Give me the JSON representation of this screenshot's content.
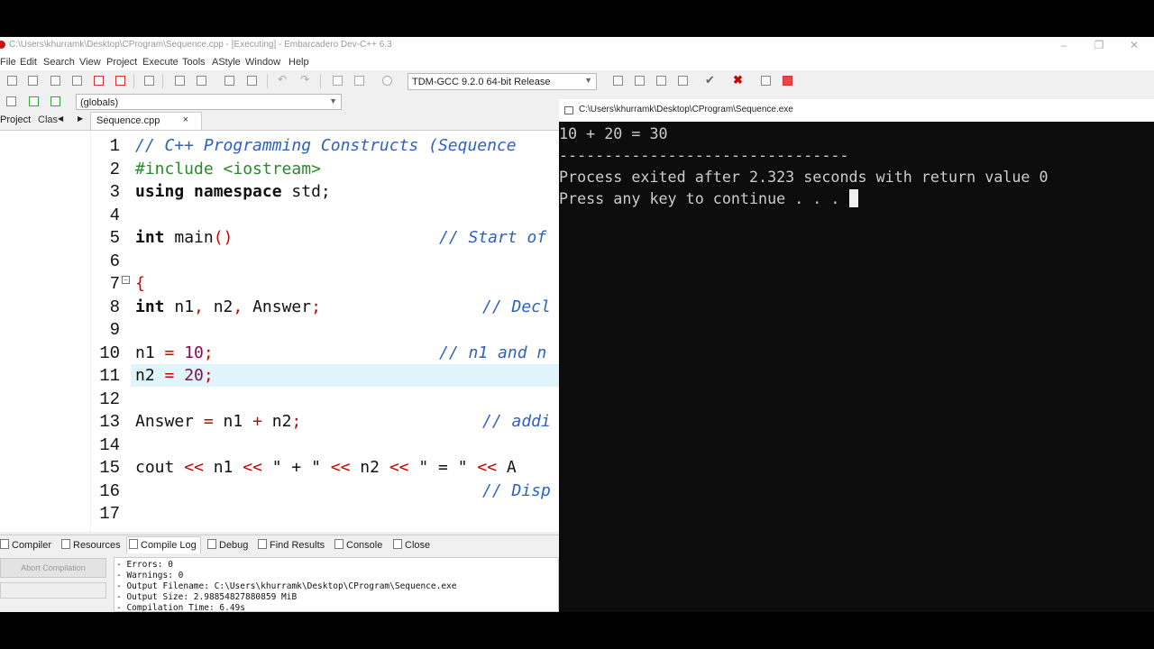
{
  "window": {
    "title": "C:\\Users\\khurramk\\Desktop\\CProgram\\Sequence.cpp - [Executing] - Embarcadero Dev-C++ 6.3"
  },
  "menu": [
    "File",
    "Edit",
    "Search",
    "View",
    "Project",
    "Execute",
    "Tools",
    "AStyle",
    "Window",
    "Help"
  ],
  "toolbar": {
    "compiler_select": "TDM-GCC 9.2.0 64-bit Release",
    "scope_select": "(globals)"
  },
  "left_tabs": {
    "project": "Project",
    "classes": "Clas"
  },
  "editor": {
    "tab_label": "Sequence.cpp",
    "tab_close": "×",
    "line_numbers": [
      "1",
      "2",
      "3",
      "4",
      "5",
      "6",
      "7",
      "8",
      "9",
      "10",
      "11",
      "12",
      "13",
      "14",
      "15",
      "16",
      "17"
    ],
    "lines": {
      "l1": "// C++ Programming Constructs (Sequence",
      "l2": "#include <iostream>",
      "l3a": "using namespace",
      "l3b": " std;",
      "l5a": "int",
      "l5b": " main",
      "l5c": "()",
      "l5d": "// Start of",
      "l7": "{",
      "l8a": "int",
      "l8b": " n1",
      "l8c": ",",
      "l8d": " n2",
      "l8e": ",",
      "l8f": " Answer",
      "l8g": ";",
      "l8h": "// Decl",
      "l10a": "n1 ",
      "l10b": "=",
      "l10c": " 10",
      "l10d": ";",
      "l10e": "// n1 and n",
      "l11a": "n2 ",
      "l11b": "=",
      "l11c": " 20",
      "l11d": ";",
      "l13a": "Answer ",
      "l13b": "=",
      "l13c": " n1 ",
      "l13d": "+",
      "l13e": " n2",
      "l13f": ";",
      "l13g": "// addi",
      "l15a": "cout ",
      "l15b": "<<",
      "l15c": " n1 ",
      "l15d": "<<",
      "l15e": " \" + \" ",
      "l15f": "<<",
      "l15g": " n2 ",
      "l15h": "<<",
      "l15i": " \" = \" ",
      "l15j": "<<",
      "l15k": " A",
      "l16": "// Disp"
    }
  },
  "bottom_tabs": [
    "Compiler",
    "Resources",
    "Compile Log",
    "Debug",
    "Find Results",
    "Console",
    "Close"
  ],
  "compile": {
    "abort_label": "Abort Compilation",
    "log": [
      "- Errors: 0",
      "- Warnings: 0",
      "- Output Filename: C:\\Users\\khurramk\\Desktop\\CProgram\\Sequence.exe",
      "- Output Size: 2.98854827880859 MiB",
      "- Compilation Time: 6.49s"
    ]
  },
  "console": {
    "title": "C:\\Users\\khurramk\\Desktop\\CProgram\\Sequence.exe",
    "lines": [
      "10 + 20 = 30",
      "--------------------------------",
      "Process exited after 2.323 seconds with return value 0",
      "Press any key to continue . . . "
    ]
  }
}
